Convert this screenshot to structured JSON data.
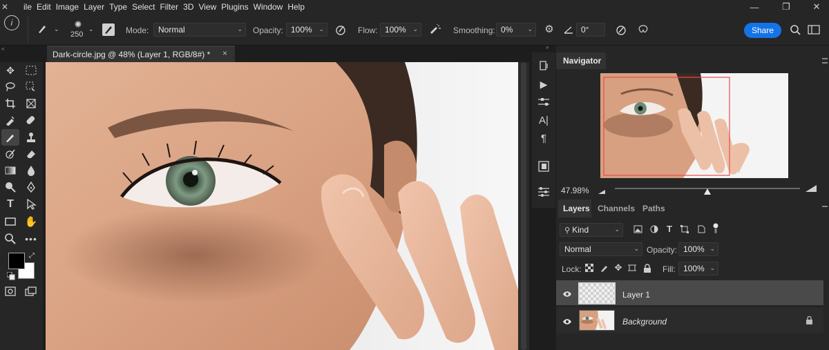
{
  "menu": [
    "ile",
    "Edit",
    "Image",
    "Layer",
    "Type",
    "Select",
    "Filter",
    "3D",
    "View",
    "Plugins",
    "Window",
    "Help"
  ],
  "options": {
    "brush_size": "250",
    "mode_label": "Mode:",
    "mode_value": "Normal",
    "opacity_label": "Opacity:",
    "opacity_value": "100%",
    "flow_label": "Flow:",
    "flow_value": "100%",
    "smoothing_label": "Smoothing:",
    "smoothing_value": "0%",
    "angle_value": "0°",
    "share_label": "Share"
  },
  "document": {
    "tab_title": "Dark-circle.jpg @ 48% (Layer 1, RGB/8#) *",
    "close_glyph": "×"
  },
  "navigator": {
    "tab_label": "Navigator",
    "zoom": "47.98%",
    "zoom_level": 0.5
  },
  "layers_panel": {
    "tabs": [
      "Layers",
      "Channels",
      "Paths"
    ],
    "filter_kind": "Kind",
    "blend_mode": "Normal",
    "opacity_label": "Opacity:",
    "opacity_value": "100%",
    "lock_label": "Lock:",
    "fill_label": "Fill:",
    "fill_value": "100%",
    "layers": [
      {
        "name": "Layer 1",
        "selected": true
      },
      {
        "name": "Background",
        "selected": false,
        "locked": true
      }
    ]
  },
  "colors": {
    "accent": "#1473e6",
    "panel": "#262626",
    "navigator_frame": "#e84b4b"
  }
}
